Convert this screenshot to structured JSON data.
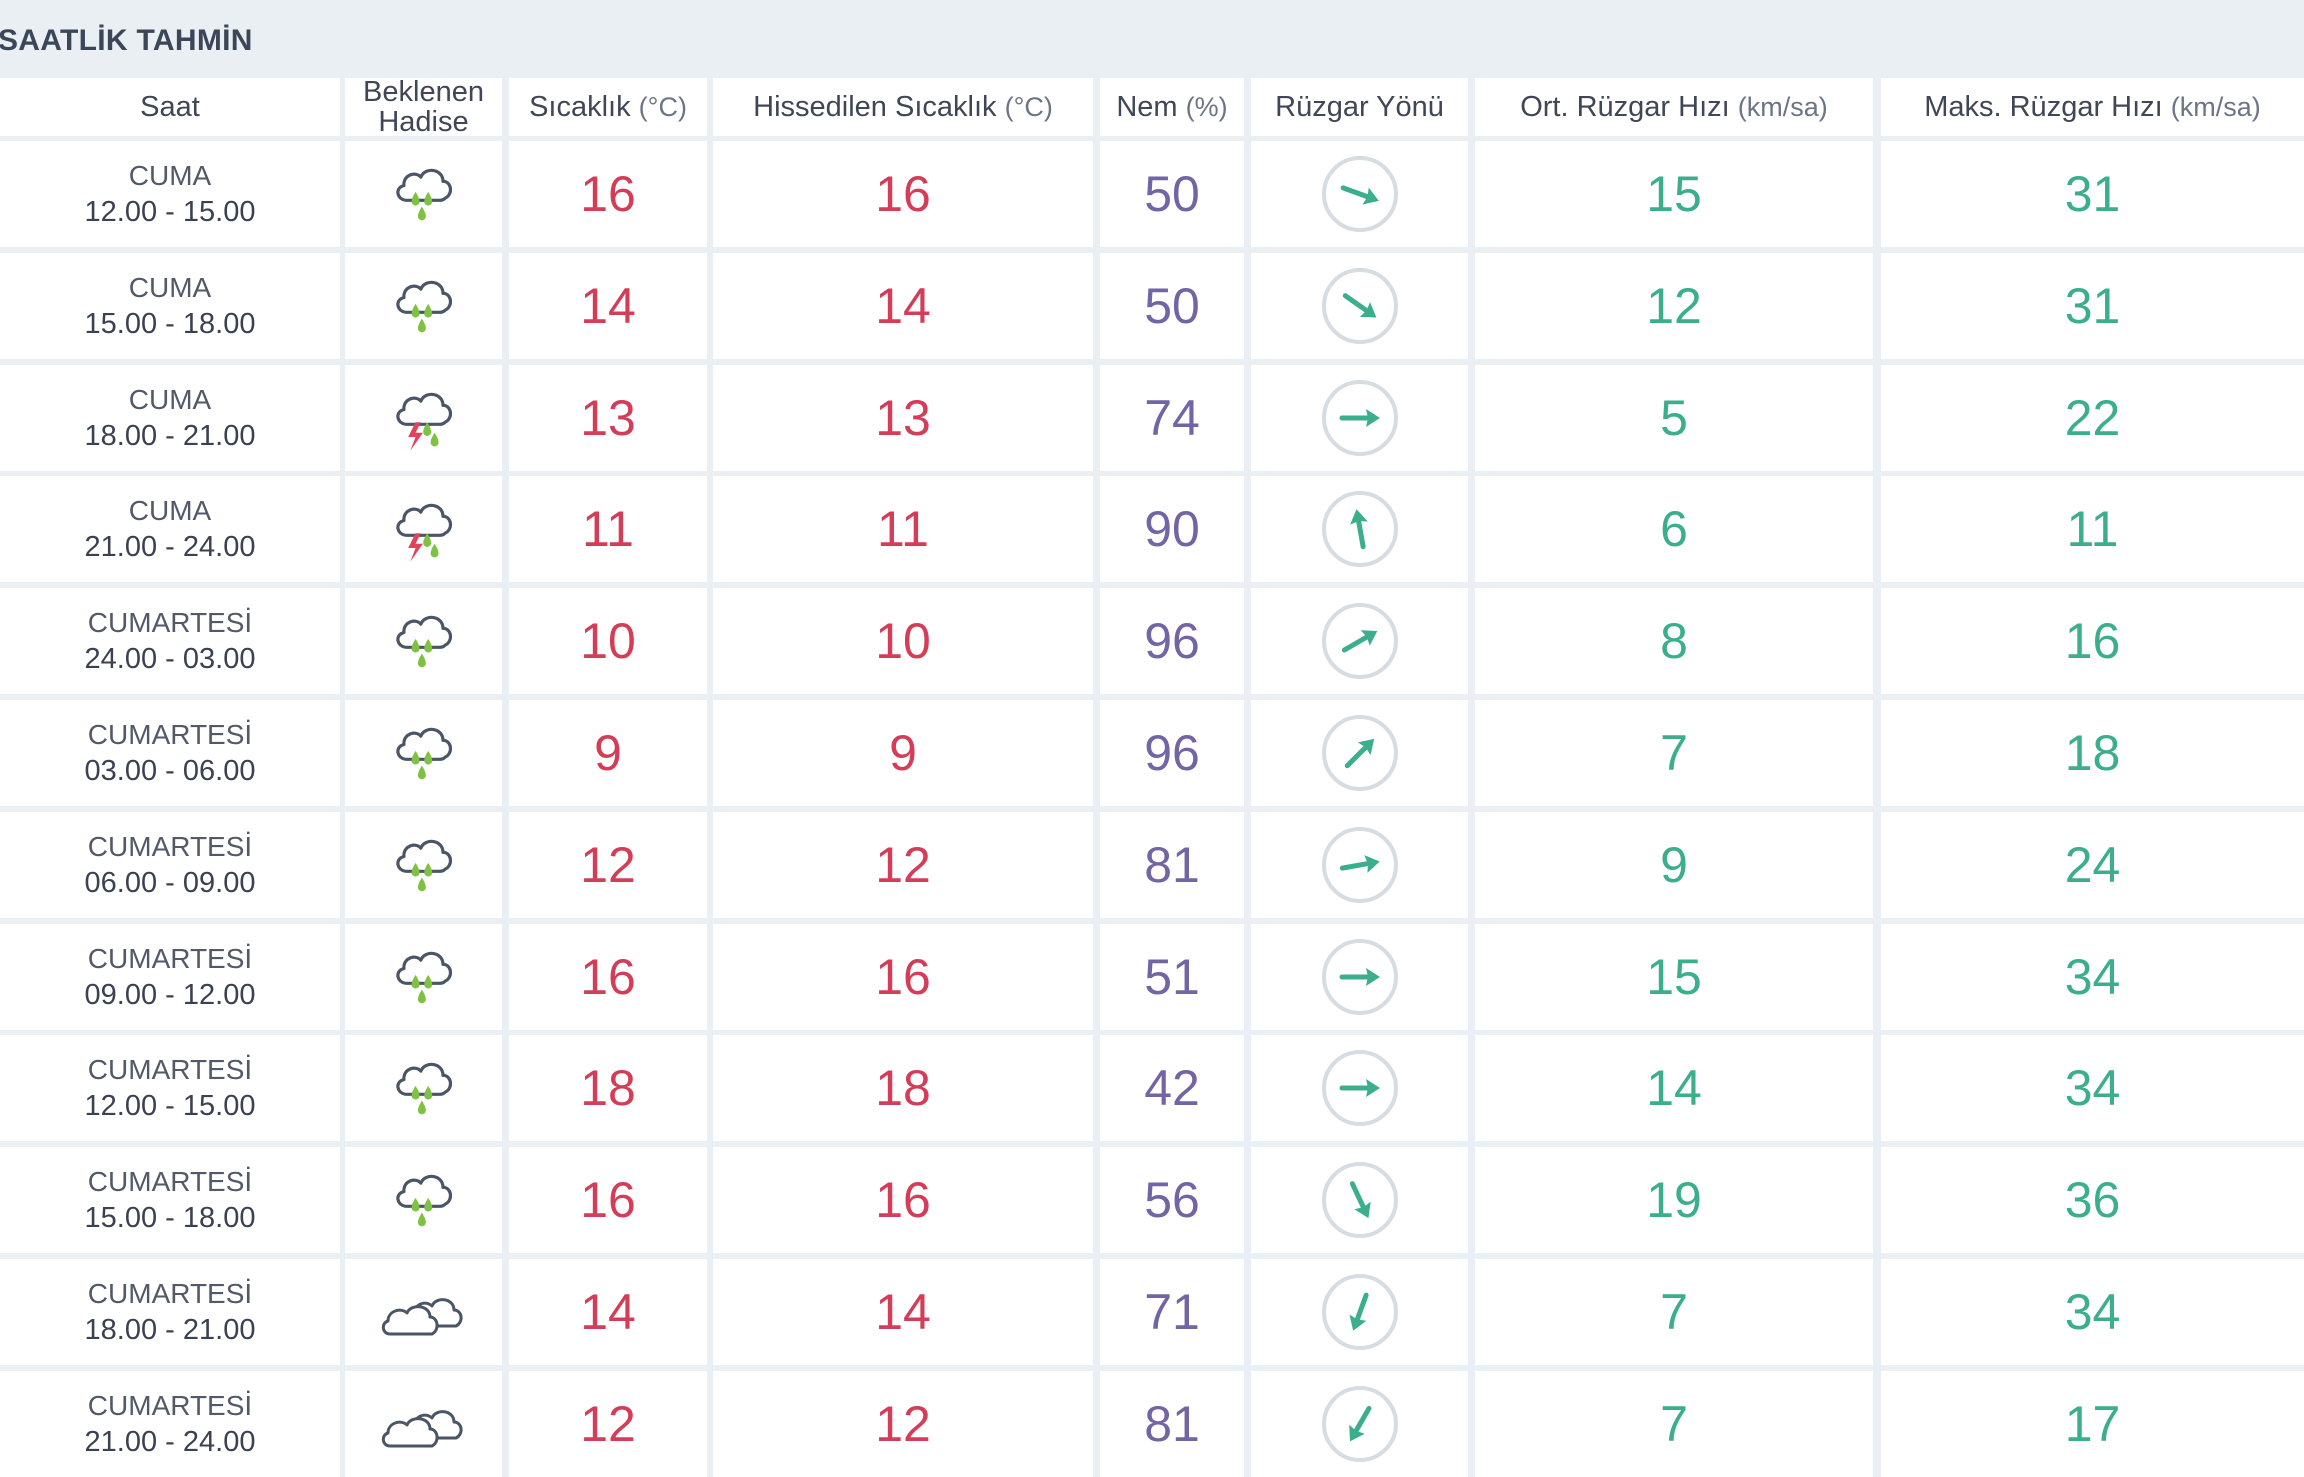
{
  "section_title": "SAATLİK TAHMİN",
  "headers": {
    "saat": "Saat",
    "hadise_line1": "Beklenen",
    "hadise_line2": "Hadise",
    "sicaklik": "Sıcaklık",
    "sicaklik_unit": "(°C)",
    "hissedilen": "Hissedilen Sıcaklık",
    "hissedilen_unit": "(°C)",
    "nem": "Nem",
    "nem_unit": "(%)",
    "ruzgar_yonu": "Rüzgar Yönü",
    "ort_ruzgar": "Ort. Rüzgar Hızı",
    "ort_ruzgar_unit": "(km/sa)",
    "maks_ruzgar": "Maks. Rüzgar Hızı",
    "maks_ruzgar_unit": "(km/sa)"
  },
  "colors": {
    "temperature": "#d33d57",
    "humidity": "#7265a4",
    "wind": "#3bae8c",
    "rain_drop": "#7dc242",
    "lightning": "#e0435a",
    "cloud_outline": "#4a5566",
    "compass_ring": "#d6dde2"
  },
  "rows": [
    {
      "day": "CUMA",
      "hours": "12.00 - 15.00",
      "icon": "rain-cloud-icon",
      "temp": "16",
      "feels": "16",
      "humidity": "50",
      "wind_direction_deg": 110,
      "wind_avg": "15",
      "wind_max": "31"
    },
    {
      "day": "CUMA",
      "hours": "15.00 - 18.00",
      "icon": "rain-cloud-icon",
      "temp": "14",
      "feels": "14",
      "humidity": "50",
      "wind_direction_deg": 125,
      "wind_avg": "12",
      "wind_max": "31"
    },
    {
      "day": "CUMA",
      "hours": "18.00 - 21.00",
      "icon": "thunderstorm-icon",
      "temp": "13",
      "feels": "13",
      "humidity": "74",
      "wind_direction_deg": 90,
      "wind_avg": "5",
      "wind_max": "22"
    },
    {
      "day": "CUMA",
      "hours": "21.00 - 24.00",
      "icon": "thunderstorm-icon",
      "temp": "11",
      "feels": "11",
      "humidity": "90",
      "wind_direction_deg": -10,
      "wind_avg": "6",
      "wind_max": "11"
    },
    {
      "day": "CUMARTESİ",
      "hours": "24.00 - 03.00",
      "icon": "rain-cloud-icon",
      "temp": "10",
      "feels": "10",
      "humidity": "96",
      "wind_direction_deg": 60,
      "wind_avg": "8",
      "wind_max": "16"
    },
    {
      "day": "CUMARTESİ",
      "hours": "03.00 - 06.00",
      "icon": "rain-cloud-icon",
      "temp": "9",
      "feels": "9",
      "humidity": "96",
      "wind_direction_deg": 45,
      "wind_avg": "7",
      "wind_max": "18"
    },
    {
      "day": "CUMARTESİ",
      "hours": "06.00 - 09.00",
      "icon": "rain-cloud-icon",
      "temp": "12",
      "feels": "12",
      "humidity": "81",
      "wind_direction_deg": 80,
      "wind_avg": "9",
      "wind_max": "24"
    },
    {
      "day": "CUMARTESİ",
      "hours": "09.00 - 12.00",
      "icon": "rain-cloud-icon",
      "temp": "16",
      "feels": "16",
      "humidity": "51",
      "wind_direction_deg": 90,
      "wind_avg": "15",
      "wind_max": "34"
    },
    {
      "day": "CUMARTESİ",
      "hours": "12.00 - 15.00",
      "icon": "rain-cloud-icon",
      "temp": "18",
      "feels": "18",
      "humidity": "42",
      "wind_direction_deg": 90,
      "wind_avg": "14",
      "wind_max": "34"
    },
    {
      "day": "CUMARTESİ",
      "hours": "15.00 - 18.00",
      "icon": "rain-cloud-icon",
      "temp": "16",
      "feels": "16",
      "humidity": "56",
      "wind_direction_deg": 155,
      "wind_avg": "19",
      "wind_max": "36"
    },
    {
      "day": "CUMARTESİ",
      "hours": "18.00 - 21.00",
      "icon": "cloudy-icon",
      "temp": "14",
      "feels": "14",
      "humidity": "71",
      "wind_direction_deg": 200,
      "wind_avg": "7",
      "wind_max": "34"
    },
    {
      "day": "CUMARTESİ",
      "hours": "21.00 - 24.00",
      "icon": "cloudy-icon",
      "temp": "12",
      "feels": "12",
      "humidity": "81",
      "wind_direction_deg": 210,
      "wind_avg": "7",
      "wind_max": "17"
    }
  ]
}
